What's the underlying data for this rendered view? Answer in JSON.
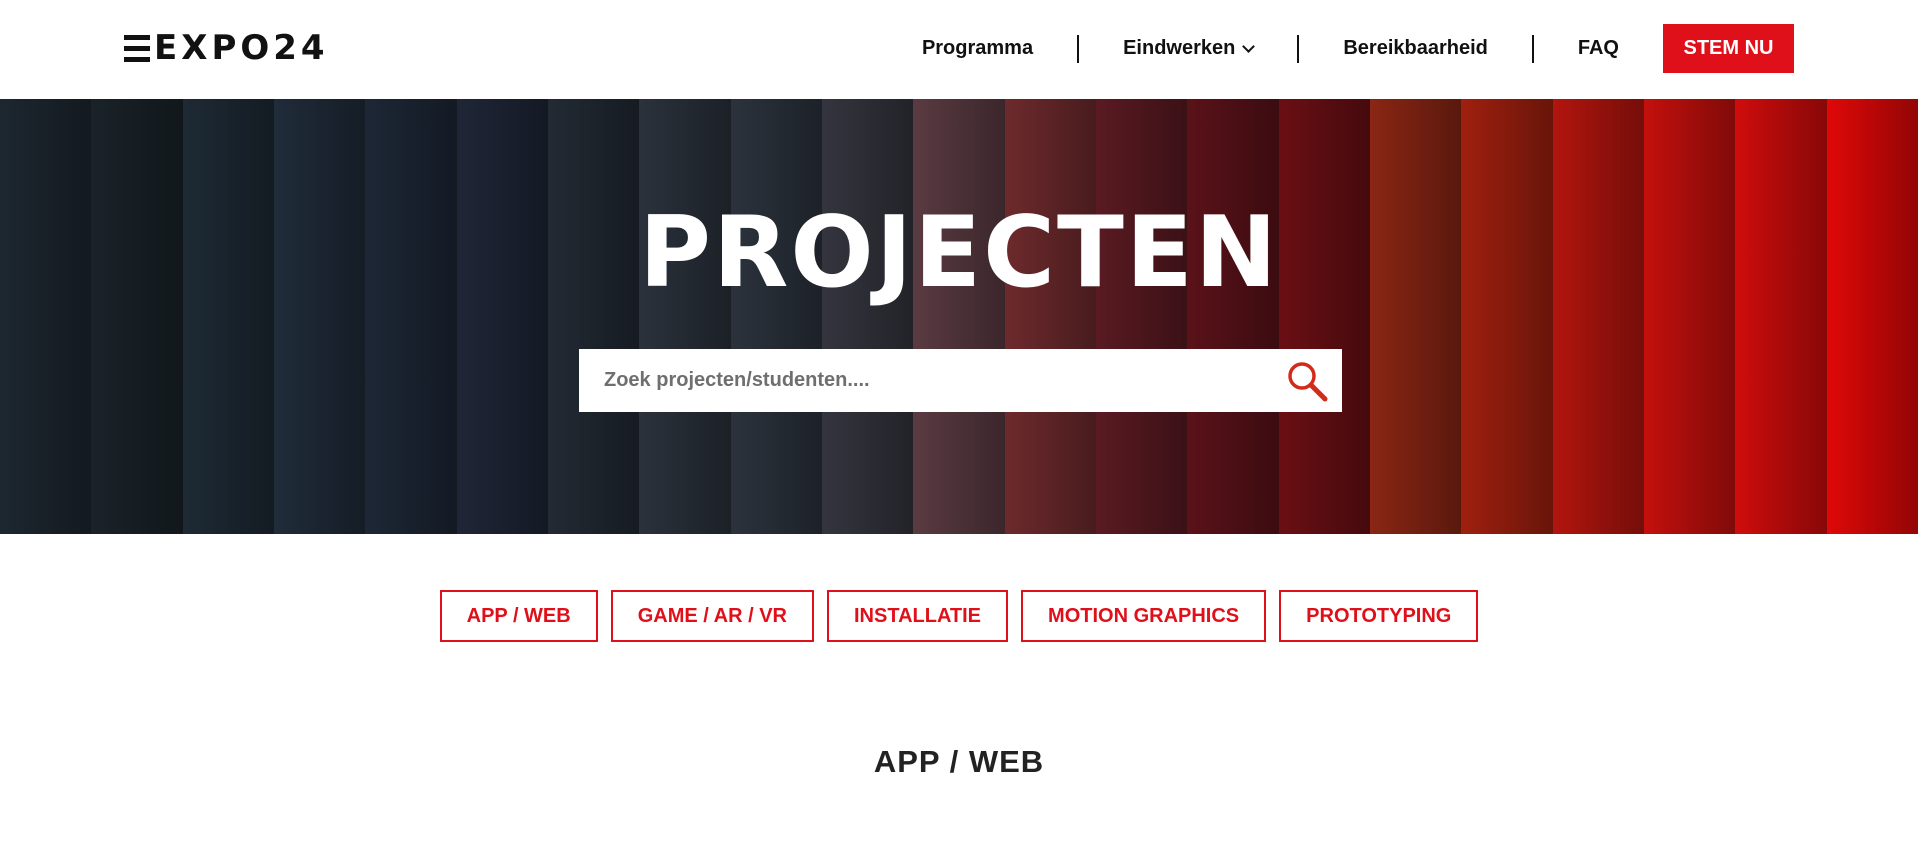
{
  "header": {
    "logo": "EXPO24",
    "nav": [
      {
        "label": "Programma"
      },
      {
        "label": "Eindwerken"
      },
      {
        "label": "Bereikbaarheid"
      },
      {
        "label": "FAQ"
      }
    ],
    "cta_label": "STEM NU"
  },
  "hero": {
    "title": "PROJECTEN",
    "search": {
      "placeholder": "Zoek projecten/studenten....",
      "value": ""
    }
  },
  "filters": [
    "APP / WEB",
    "GAME / AR / VR",
    "INSTALLATIE",
    "MOTION GRAPHICS",
    "PROTOTYPING"
  ],
  "section_title": "APP / WEB",
  "colors": {
    "accent": "#e0101a",
    "text": "#111111",
    "hero_stripes": [
      "#1d2730",
      "#1a2329",
      "#1e2a35",
      "#202c3a",
      "#1d2736",
      "#1f2637",
      "#222a34",
      "#2b323c",
      "#2c333d",
      "#34353e",
      "#5a3b42",
      "#6e2a2d",
      "#5a1a22",
      "#5a1219",
      "#6a0f14",
      "#8a2614",
      "#a0200f",
      "#b3150e",
      "#c4100d",
      "#d00c0c",
      "#e00808"
    ]
  },
  "icons": {
    "search": "magnifier-icon",
    "dropdown": "chevron-down-icon"
  }
}
